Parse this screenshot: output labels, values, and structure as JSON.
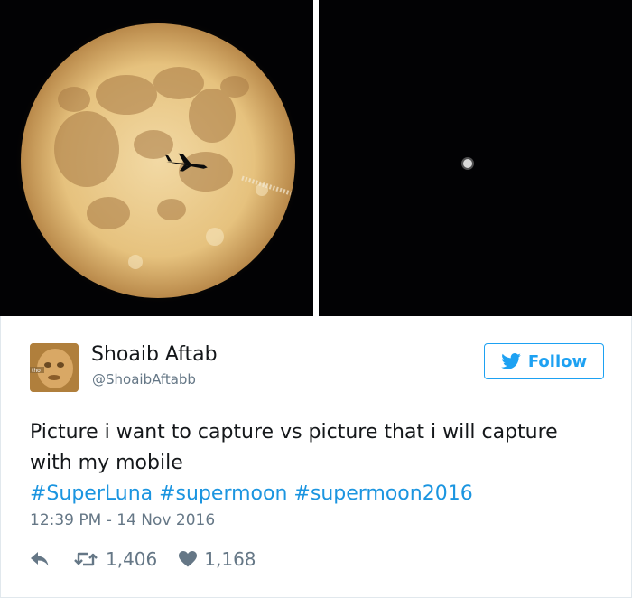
{
  "tweet": {
    "display_name": "Shoaib Aftab",
    "handle": "@ShoaibAftabb",
    "avatar_caption": "tho",
    "follow_label": "Follow",
    "text": "Picture i want to capture vs picture that i will capture with my mobile",
    "hashtags": [
      "#SuperLuna",
      "#supermoon",
      "#supermoon2016"
    ],
    "timestamp": "12:39 PM - 14 Nov 2016",
    "retweets": "1,406",
    "likes": "1,168"
  },
  "colors": {
    "accent": "#1da1f2",
    "hashtag": "#1b95e0",
    "muted": "#657786",
    "text": "#14171a"
  },
  "icons": [
    "reply-icon",
    "retweet-icon",
    "heart-icon",
    "twitter-bird-icon"
  ]
}
